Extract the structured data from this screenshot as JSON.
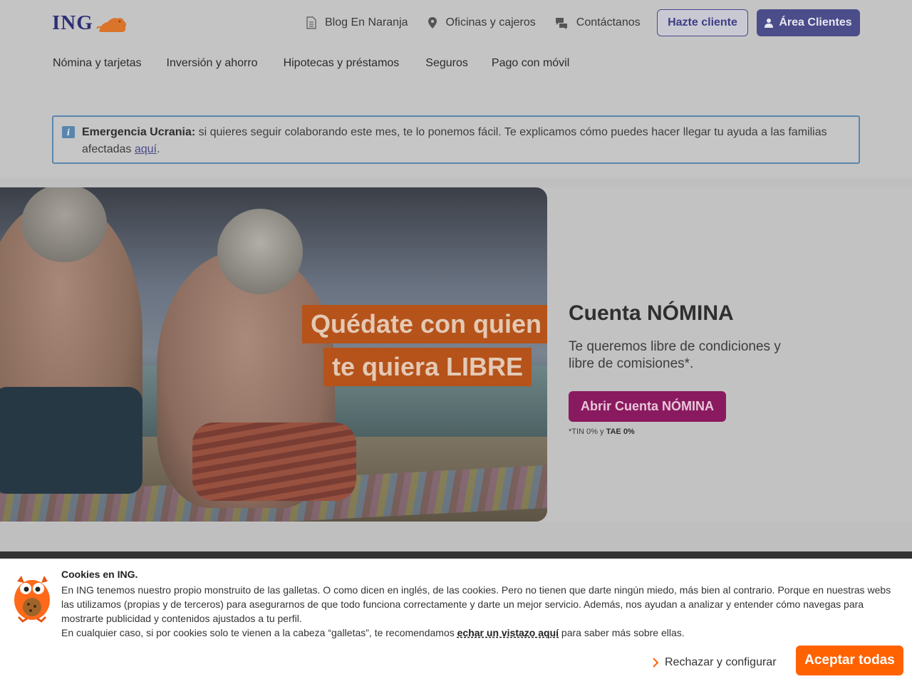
{
  "header": {
    "logo_text": "ING",
    "topnav": [
      {
        "label": "Blog En Naranja",
        "icon": "document-icon"
      },
      {
        "label": "Oficinas y cajeros",
        "icon": "location-pin-icon"
      },
      {
        "label": "Contáctanos",
        "icon": "chat-bubbles-icon"
      }
    ],
    "hazte_cliente": "Hazte cliente",
    "area_clientes": "Área Clientes"
  },
  "mainnav": [
    "Nómina y tarjetas",
    "Inversión y ahorro",
    "Hipotecas y préstamos",
    "Seguros",
    "Pago con móvil"
  ],
  "alert": {
    "bold": "Emergencia Ucrania:",
    "text": " si quieres seguir colaborando este mes, te lo ponemos fácil. Te explicamos cómo puedes hacer llegar tu ayuda a las familias afectadas ",
    "link": "aquí",
    "end": "."
  },
  "hero": {
    "headline_line1": "Quédate con quien",
    "headline_line2": "te quiera LIBRE",
    "title": "Cuenta NÓMINA",
    "description": "Te queremos libre de condiciones y libre de comisiones*.",
    "cta": "Abrir Cuenta NÓMINA",
    "legal_prefix": "*TIN 0% y ",
    "legal_bold": "TAE 0%"
  },
  "cookies": {
    "title": "Cookies en ING.",
    "text": "En ING tenemos nuestro propio monstruito de las galletas. O como dicen en inglés, de las cookies. Pero no tienen que darte ningún miedo, más bien al contrario. Porque en nuestras webs las utilizamos (propias y de terceros) para asegurarnos de que todo funciona correctamente y darte un mejor servicio. Además, nos ayudan a analizar y entender cómo navegas para mostrarte publicidad y contenidos ajustados a tu perfil.",
    "text2_prefix": "En cualquier caso, si por cookies solo te vienen a la cabeza “galletas”, te recomendamos ",
    "text2_link": "echar un vistazo aquí",
    "text2_suffix": " para saber más sobre ellas.",
    "reject": "Rechazar y configurar",
    "accept": "Aceptar todas"
  },
  "colors": {
    "ing_orange": "#ff6200",
    "ing_navy": "#2d2f76",
    "cta_purple": "#8a1a5f"
  }
}
